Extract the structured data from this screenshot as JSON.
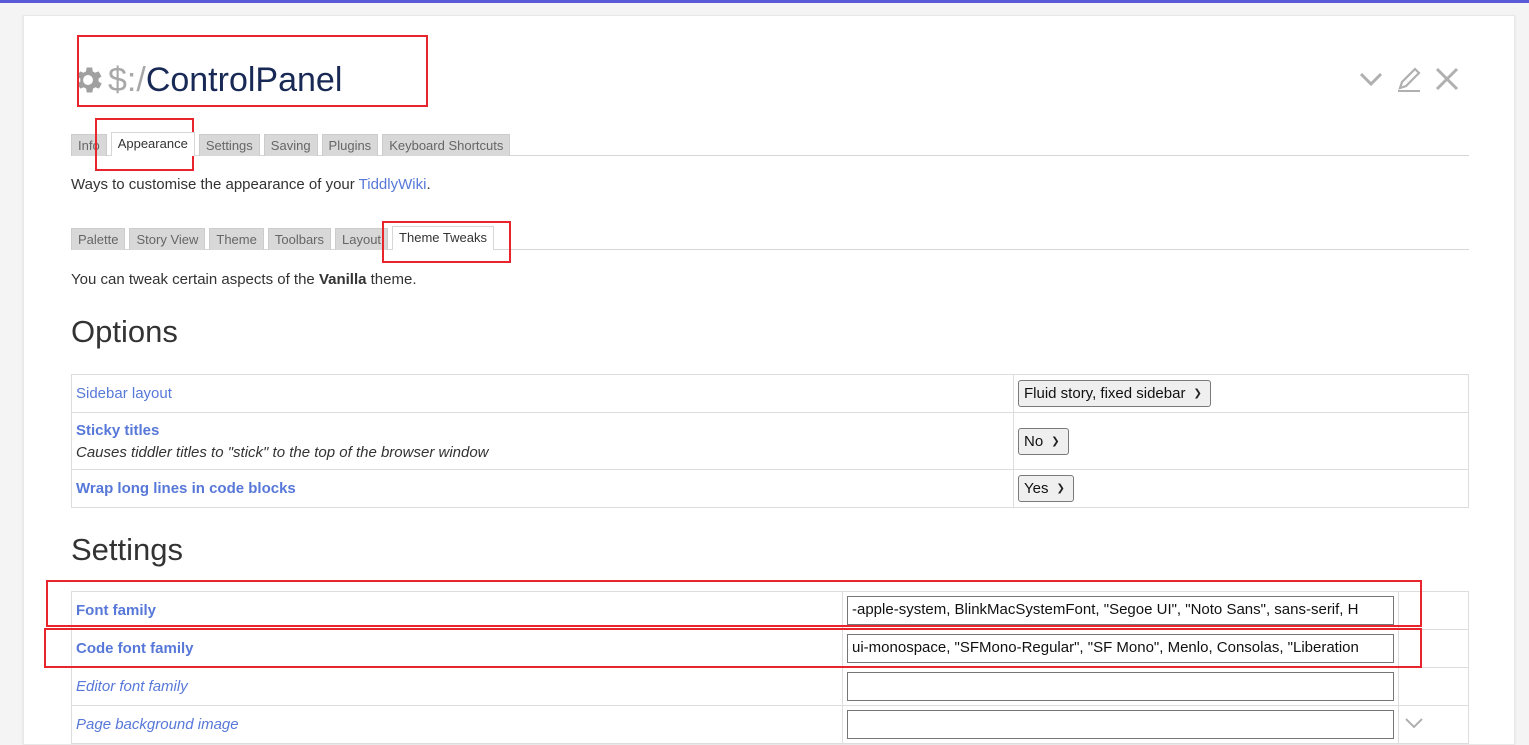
{
  "window": {
    "title_prefix": "$:/",
    "title_main": "ControlPanel",
    "icons": [
      "gear-icon",
      "chevron-down-icon",
      "edit-icon",
      "close-icon"
    ],
    "accent": "#5778d8",
    "title_color": "#182955",
    "highlight_color": "#e8252c"
  },
  "tabs": {
    "main": [
      "Info",
      "Appearance",
      "Settings",
      "Saving",
      "Plugins",
      "Keyboard Shortcuts"
    ],
    "main_active": "Appearance",
    "sub": [
      "Palette",
      "Story View",
      "Theme",
      "Toolbars",
      "Layout",
      "Theme Tweaks"
    ],
    "sub_active": "Theme Tweaks"
  },
  "appearance": {
    "intro_before": "Ways to customise the appearance of your ",
    "intro_link": "TiddlyWiki",
    "intro_after": "."
  },
  "tweaks": {
    "intro_before": "You can tweak certain aspects of the ",
    "intro_bold": "Vanilla",
    "intro_after": " theme."
  },
  "options": {
    "heading": "Options",
    "rows": [
      {
        "label": "Sidebar layout",
        "value": "Fluid story, fixed sidebar"
      },
      {
        "label": "Sticky titles",
        "description": "Causes tiddler titles to \"stick\" to the top of the browser window",
        "value": "No"
      },
      {
        "label": "Wrap long lines in code blocks",
        "value": "Yes"
      }
    ]
  },
  "settings": {
    "heading": "Settings",
    "rows": [
      {
        "label": "Font family",
        "value": "-apple-system, BlinkMacSystemFont, \"Segoe UI\", \"Noto Sans\", sans-serif, H"
      },
      {
        "label": "Code font family",
        "value": "ui-monospace, \"SFMono-Regular\", \"SF Mono\", Menlo, Consolas, \"Liberation"
      },
      {
        "label": "Editor font family",
        "value": ""
      },
      {
        "label": "Page background image",
        "value": ""
      }
    ]
  }
}
